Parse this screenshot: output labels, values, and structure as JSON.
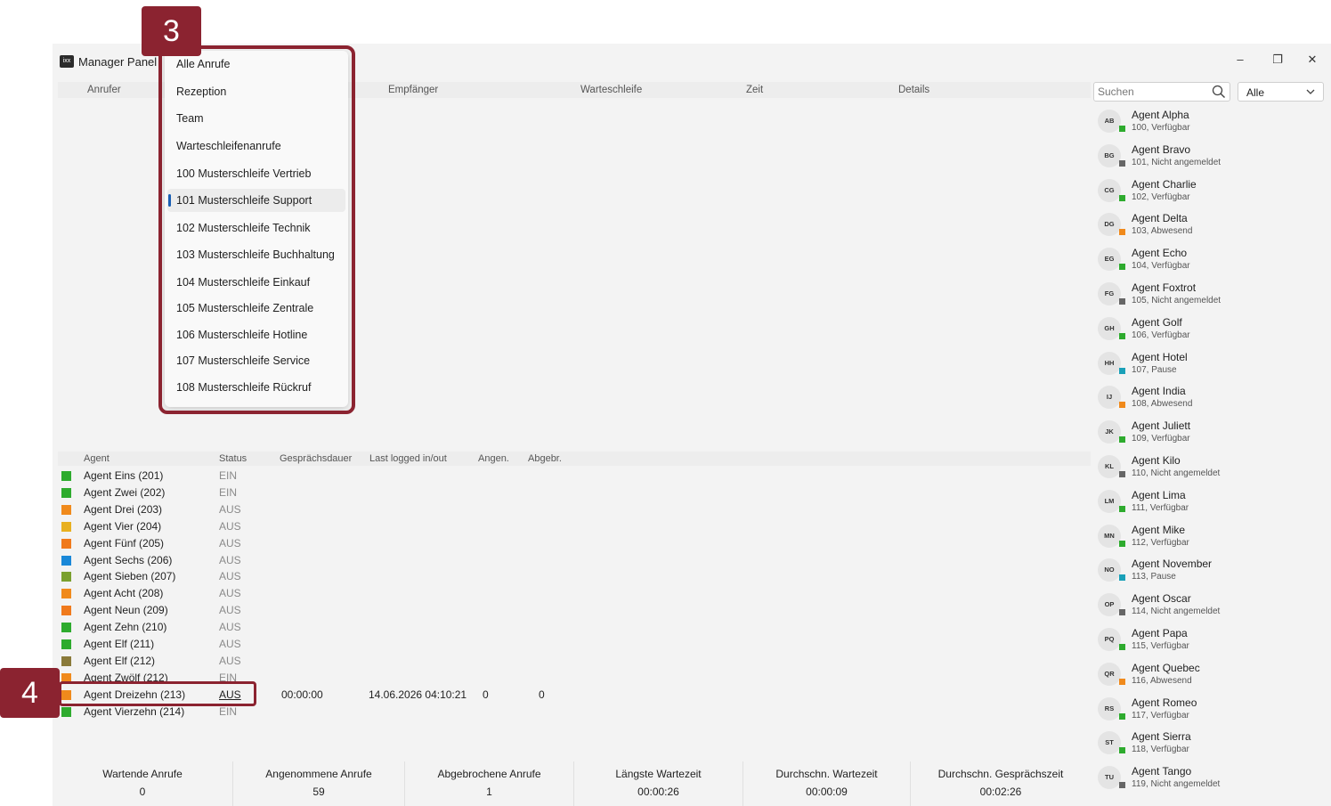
{
  "window": {
    "title": "Manager Panel",
    "logo_text": "ixx",
    "controls": {
      "minimize": "–",
      "maximize": "❐",
      "close": "✕"
    }
  },
  "calls_table": {
    "columns": [
      "Anrufer",
      "Empfänger",
      "Warteschleife",
      "Zeit",
      "Details"
    ]
  },
  "search": {
    "placeholder": "Suchen"
  },
  "filter": {
    "selected": "Alle"
  },
  "dropdown": {
    "items": [
      "Alle Anrufe",
      "Rezeption",
      "Team",
      "Warteschleifenanrufe",
      "100 Musterschleife Vertrieb",
      "101 Musterschleife Support",
      "102 Musterschleife Technik",
      "103 Musterschleife Buchhaltung",
      "104 Musterschleife Einkauf",
      "105 Musterschleife Zentrale",
      "106 Musterschleife Hotline",
      "107 Musterschleife Service",
      "108 Musterschleife Rückruf"
    ],
    "active_index": 5
  },
  "agents_table": {
    "columns": [
      "Agent",
      "Status",
      "Gesprächsdauer",
      "Last logged in/out",
      "Angen.",
      "Abgebr."
    ],
    "rows": [
      {
        "name": "Agent Eins (201)",
        "status": "EIN",
        "color": "#2eab2e"
      },
      {
        "name": "Agent Zwei (202)",
        "status": "EIN",
        "color": "#2eab2e"
      },
      {
        "name": "Agent Drei (203)",
        "status": "AUS",
        "color": "#f08a1c"
      },
      {
        "name": "Agent Vier (204)",
        "status": "AUS",
        "color": "#e8b020"
      },
      {
        "name": "Agent Fünf (205)",
        "status": "AUS",
        "color": "#f07a1c"
      },
      {
        "name": "Agent Sechs (206)",
        "status": "AUS",
        "color": "#1a88d8"
      },
      {
        "name": "Agent Sieben (207)",
        "status": "AUS",
        "color": "#7aa02e"
      },
      {
        "name": "Agent Acht (208)",
        "status": "AUS",
        "color": "#f08a1c"
      },
      {
        "name": "Agent Neun (209)",
        "status": "AUS",
        "color": "#f07a1c"
      },
      {
        "name": "Agent Zehn (210)",
        "status": "AUS",
        "color": "#2eab2e"
      },
      {
        "name": "Agent Elf (211)",
        "status": "AUS",
        "color": "#2eab2e"
      },
      {
        "name": "Agent Elf (212)",
        "status": "AUS",
        "color": "#8a7a3a"
      },
      {
        "name": "Agent Zwölf (212)",
        "status": "EIN",
        "color": "#f08a1c"
      },
      {
        "name": "Agent Dreizehn (213)",
        "status": "AUS",
        "color": "#f08a1c",
        "duration": "00:00:00",
        "last_logged": "14.06.2026 04:10:21",
        "accepted": "0",
        "aborted": "0"
      },
      {
        "name": "Agent Vierzehn (214)",
        "status": "EIN",
        "color": "#2eab2e"
      }
    ]
  },
  "stats": [
    {
      "label": "Wartende Anrufe",
      "value": "0"
    },
    {
      "label": "Angenommene Anrufe",
      "value": "59"
    },
    {
      "label": "Abgebrochene Anrufe",
      "value": "1"
    },
    {
      "label": "Längste Wartezeit",
      "value": "00:00:26"
    },
    {
      "label": "Durchschn. Wartezeit",
      "value": "00:00:09"
    },
    {
      "label": "Durchschn. Gesprächszeit",
      "value": "00:02:26"
    }
  ],
  "sidebar_agents": [
    {
      "initials": "AB",
      "name": "Agent Alpha",
      "sub": "100, Verfügbar",
      "color": "#2eab2e"
    },
    {
      "initials": "BG",
      "name": "Agent Bravo",
      "sub": "101, Nicht angemeldet",
      "color": "#666666"
    },
    {
      "initials": "CG",
      "name": "Agent Charlie",
      "sub": "102, Verfügbar",
      "color": "#2eab2e"
    },
    {
      "initials": "DG",
      "name": "Agent Delta",
      "sub": "103, Abwesend",
      "color": "#f08a1c"
    },
    {
      "initials": "EG",
      "name": "Agent Echo",
      "sub": "104, Verfügbar",
      "color": "#2eab2e"
    },
    {
      "initials": "FG",
      "name": "Agent Foxtrot",
      "sub": "105, Nicht angemeldet",
      "color": "#666666"
    },
    {
      "initials": "GH",
      "name": "Agent Golf",
      "sub": "106, Verfügbar",
      "color": "#2eab2e"
    },
    {
      "initials": "HH",
      "name": "Agent Hotel",
      "sub": "107, Pause",
      "color": "#1aa0b8"
    },
    {
      "initials": "IJ",
      "name": "Agent India",
      "sub": "108, Abwesend",
      "color": "#f08a1c"
    },
    {
      "initials": "JK",
      "name": "Agent Juliett",
      "sub": "109, Verfügbar",
      "color": "#2eab2e"
    },
    {
      "initials": "KL",
      "name": "Agent Kilo",
      "sub": "110, Nicht angemeldet",
      "color": "#666666"
    },
    {
      "initials": "LM",
      "name": "Agent Lima",
      "sub": "111, Verfügbar",
      "color": "#2eab2e"
    },
    {
      "initials": "MN",
      "name": "Agent Mike",
      "sub": "112, Verfügbar",
      "color": "#2eab2e"
    },
    {
      "initials": "NO",
      "name": "Agent November",
      "sub": "113, Pause",
      "color": "#1aa0b8"
    },
    {
      "initials": "OP",
      "name": "Agent Oscar",
      "sub": "114, Nicht angemeldet",
      "color": "#666666"
    },
    {
      "initials": "PQ",
      "name": "Agent Papa",
      "sub": "115, Verfügbar",
      "color": "#2eab2e"
    },
    {
      "initials": "QR",
      "name": "Agent Quebec",
      "sub": "116, Abwesend",
      "color": "#f08a1c"
    },
    {
      "initials": "RS",
      "name": "Agent Romeo",
      "sub": "117, Verfügbar",
      "color": "#2eab2e"
    },
    {
      "initials": "ST",
      "name": "Agent Sierra",
      "sub": "118, Verfügbar",
      "color": "#2eab2e"
    },
    {
      "initials": "TU",
      "name": "Agent Tango",
      "sub": "119, Nicht angemeldet",
      "color": "#666666"
    }
  ],
  "callouts": {
    "dropdown": "3",
    "agent_row": "4"
  },
  "accent_color": "#8b2330"
}
